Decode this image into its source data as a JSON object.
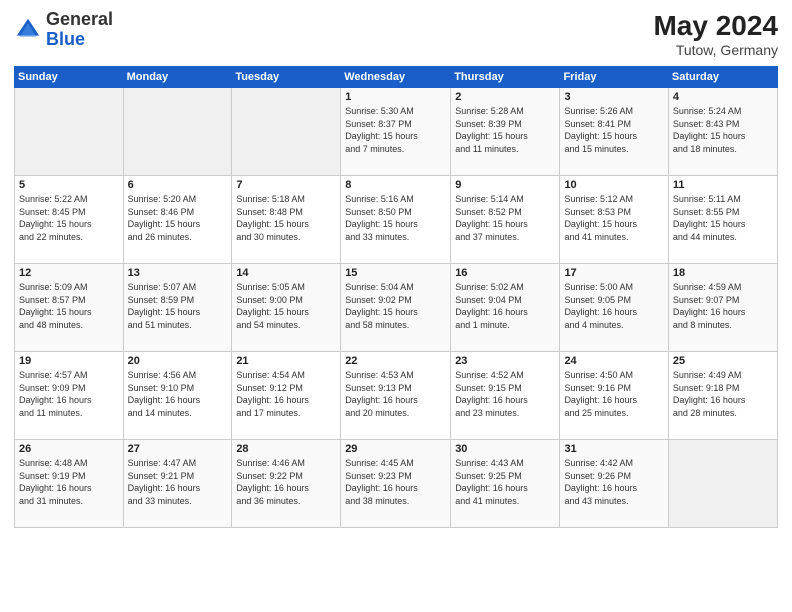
{
  "header": {
    "logo_general": "General",
    "logo_blue": "Blue",
    "month_year": "May 2024",
    "location": "Tutow, Germany"
  },
  "weekdays": [
    "Sunday",
    "Monday",
    "Tuesday",
    "Wednesday",
    "Thursday",
    "Friday",
    "Saturday"
  ],
  "weeks": [
    [
      {
        "day": "",
        "info": ""
      },
      {
        "day": "",
        "info": ""
      },
      {
        "day": "",
        "info": ""
      },
      {
        "day": "1",
        "info": "Sunrise: 5:30 AM\nSunset: 8:37 PM\nDaylight: 15 hours\nand 7 minutes."
      },
      {
        "day": "2",
        "info": "Sunrise: 5:28 AM\nSunset: 8:39 PM\nDaylight: 15 hours\nand 11 minutes."
      },
      {
        "day": "3",
        "info": "Sunrise: 5:26 AM\nSunset: 8:41 PM\nDaylight: 15 hours\nand 15 minutes."
      },
      {
        "day": "4",
        "info": "Sunrise: 5:24 AM\nSunset: 8:43 PM\nDaylight: 15 hours\nand 18 minutes."
      }
    ],
    [
      {
        "day": "5",
        "info": "Sunrise: 5:22 AM\nSunset: 8:45 PM\nDaylight: 15 hours\nand 22 minutes."
      },
      {
        "day": "6",
        "info": "Sunrise: 5:20 AM\nSunset: 8:46 PM\nDaylight: 15 hours\nand 26 minutes."
      },
      {
        "day": "7",
        "info": "Sunrise: 5:18 AM\nSunset: 8:48 PM\nDaylight: 15 hours\nand 30 minutes."
      },
      {
        "day": "8",
        "info": "Sunrise: 5:16 AM\nSunset: 8:50 PM\nDaylight: 15 hours\nand 33 minutes."
      },
      {
        "day": "9",
        "info": "Sunrise: 5:14 AM\nSunset: 8:52 PM\nDaylight: 15 hours\nand 37 minutes."
      },
      {
        "day": "10",
        "info": "Sunrise: 5:12 AM\nSunset: 8:53 PM\nDaylight: 15 hours\nand 41 minutes."
      },
      {
        "day": "11",
        "info": "Sunrise: 5:11 AM\nSunset: 8:55 PM\nDaylight: 15 hours\nand 44 minutes."
      }
    ],
    [
      {
        "day": "12",
        "info": "Sunrise: 5:09 AM\nSunset: 8:57 PM\nDaylight: 15 hours\nand 48 minutes."
      },
      {
        "day": "13",
        "info": "Sunrise: 5:07 AM\nSunset: 8:59 PM\nDaylight: 15 hours\nand 51 minutes."
      },
      {
        "day": "14",
        "info": "Sunrise: 5:05 AM\nSunset: 9:00 PM\nDaylight: 15 hours\nand 54 minutes."
      },
      {
        "day": "15",
        "info": "Sunrise: 5:04 AM\nSunset: 9:02 PM\nDaylight: 15 hours\nand 58 minutes."
      },
      {
        "day": "16",
        "info": "Sunrise: 5:02 AM\nSunset: 9:04 PM\nDaylight: 16 hours\nand 1 minute."
      },
      {
        "day": "17",
        "info": "Sunrise: 5:00 AM\nSunset: 9:05 PM\nDaylight: 16 hours\nand 4 minutes."
      },
      {
        "day": "18",
        "info": "Sunrise: 4:59 AM\nSunset: 9:07 PM\nDaylight: 16 hours\nand 8 minutes."
      }
    ],
    [
      {
        "day": "19",
        "info": "Sunrise: 4:57 AM\nSunset: 9:09 PM\nDaylight: 16 hours\nand 11 minutes."
      },
      {
        "day": "20",
        "info": "Sunrise: 4:56 AM\nSunset: 9:10 PM\nDaylight: 16 hours\nand 14 minutes."
      },
      {
        "day": "21",
        "info": "Sunrise: 4:54 AM\nSunset: 9:12 PM\nDaylight: 16 hours\nand 17 minutes."
      },
      {
        "day": "22",
        "info": "Sunrise: 4:53 AM\nSunset: 9:13 PM\nDaylight: 16 hours\nand 20 minutes."
      },
      {
        "day": "23",
        "info": "Sunrise: 4:52 AM\nSunset: 9:15 PM\nDaylight: 16 hours\nand 23 minutes."
      },
      {
        "day": "24",
        "info": "Sunrise: 4:50 AM\nSunset: 9:16 PM\nDaylight: 16 hours\nand 25 minutes."
      },
      {
        "day": "25",
        "info": "Sunrise: 4:49 AM\nSunset: 9:18 PM\nDaylight: 16 hours\nand 28 minutes."
      }
    ],
    [
      {
        "day": "26",
        "info": "Sunrise: 4:48 AM\nSunset: 9:19 PM\nDaylight: 16 hours\nand 31 minutes."
      },
      {
        "day": "27",
        "info": "Sunrise: 4:47 AM\nSunset: 9:21 PM\nDaylight: 16 hours\nand 33 minutes."
      },
      {
        "day": "28",
        "info": "Sunrise: 4:46 AM\nSunset: 9:22 PM\nDaylight: 16 hours\nand 36 minutes."
      },
      {
        "day": "29",
        "info": "Sunrise: 4:45 AM\nSunset: 9:23 PM\nDaylight: 16 hours\nand 38 minutes."
      },
      {
        "day": "30",
        "info": "Sunrise: 4:43 AM\nSunset: 9:25 PM\nDaylight: 16 hours\nand 41 minutes."
      },
      {
        "day": "31",
        "info": "Sunrise: 4:42 AM\nSunset: 9:26 PM\nDaylight: 16 hours\nand 43 minutes."
      },
      {
        "day": "",
        "info": ""
      }
    ]
  ]
}
